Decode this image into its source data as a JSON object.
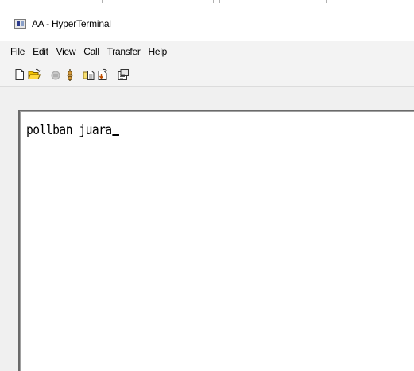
{
  "window": {
    "title": "AA - HyperTerminal"
  },
  "menu": {
    "items": [
      "File",
      "Edit",
      "View",
      "Call",
      "Transfer",
      "Help"
    ]
  },
  "toolbar": {
    "buttons": [
      {
        "icon": "new-document-icon"
      },
      {
        "icon": "open-folder-icon"
      },
      {
        "icon": "call-icon"
      },
      {
        "icon": "disconnect-icon"
      },
      {
        "icon": "send-icon"
      },
      {
        "icon": "receive-icon"
      },
      {
        "icon": "properties-icon"
      }
    ]
  },
  "terminal": {
    "text": "pollban juara"
  },
  "colors": {
    "window_bg": "#f0f0f0",
    "terminal_bg": "#ffffff",
    "terminal_border": "#6a6a6a"
  }
}
